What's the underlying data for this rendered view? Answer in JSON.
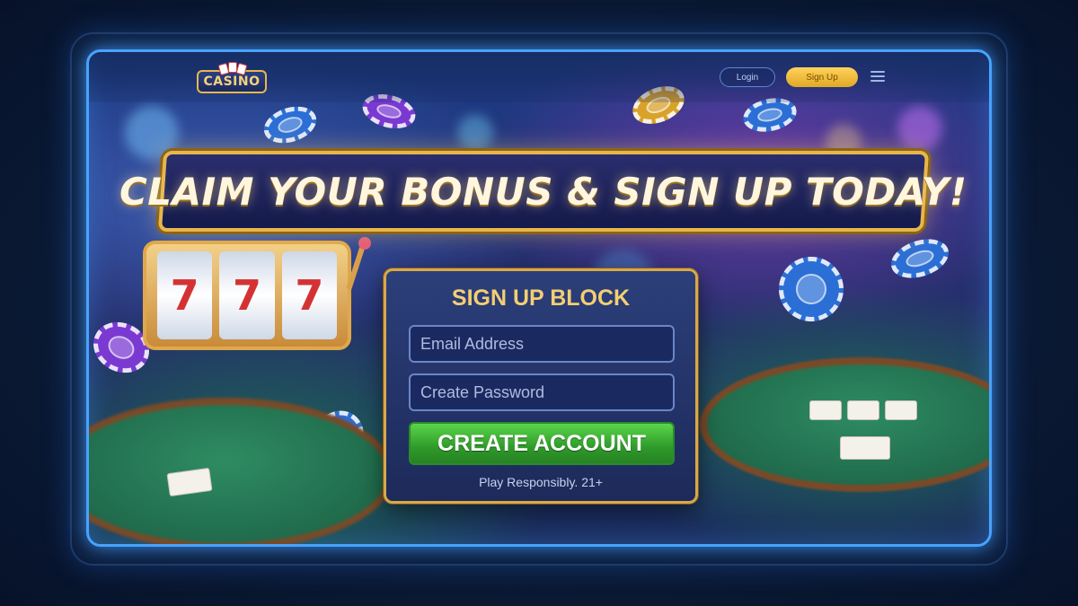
{
  "header": {
    "logo_text": "CASINO",
    "login_label": "Login",
    "signup_label": "Sign Up",
    "menu_icon": "hamburger-menu-icon"
  },
  "banner": {
    "text": "CLAIM YOUR BONUS & SIGN UP TODAY!"
  },
  "slot_machine": {
    "reels": [
      "7",
      "7",
      "7"
    ]
  },
  "signup_form": {
    "title": "SIGN UP BLOCK",
    "email_placeholder": "Email Address",
    "password_placeholder": "Create Password",
    "submit_label": "CREATE ACCOUNT",
    "disclaimer": "Play Responsibly. 21+"
  },
  "colors": {
    "accent_gold": "#e8b64a",
    "button_green": "#3fb23a",
    "screen_glow": "#47a3ff",
    "panel_navy": "#1d2a5a"
  }
}
